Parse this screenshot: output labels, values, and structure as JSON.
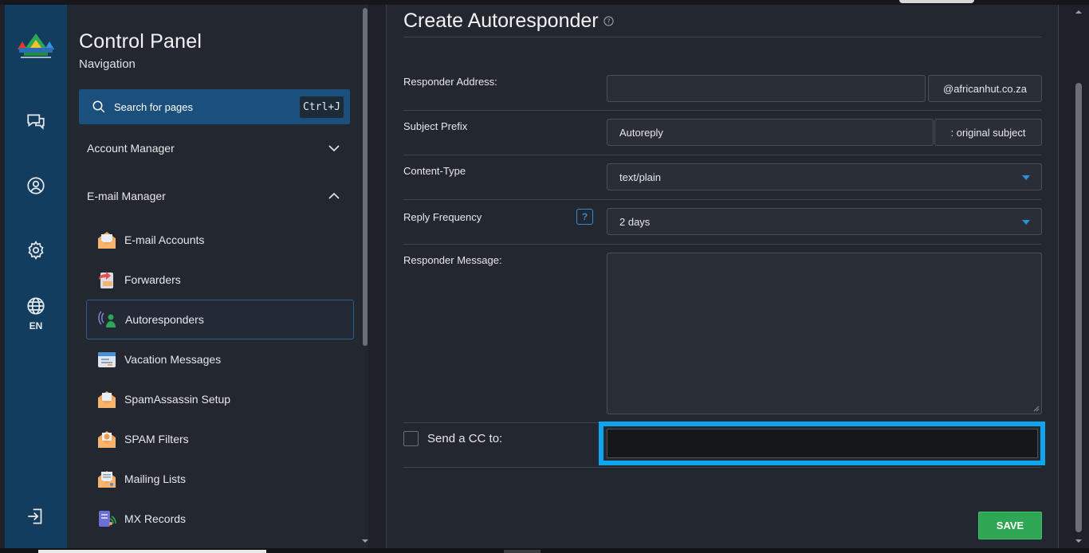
{
  "rail": {
    "language": "EN"
  },
  "sidebar": {
    "title": "Control Panel",
    "subtitle": "Navigation",
    "search": {
      "label": "Search for pages",
      "shortcut": "Ctrl+J"
    },
    "groups": [
      {
        "label": "Account Manager",
        "expanded": false
      },
      {
        "label": "E-mail Manager",
        "expanded": true
      }
    ],
    "items": [
      {
        "label": "E-mail Accounts",
        "icon": "envelope-open-icon"
      },
      {
        "label": "Forwarders",
        "icon": "forward-mail-icon"
      },
      {
        "label": "Autoresponders",
        "icon": "autoresponder-person-icon",
        "active": true
      },
      {
        "label": "Vacation Messages",
        "icon": "calendar-message-icon"
      },
      {
        "label": "SpamAssassin Setup",
        "icon": "envelope-filter-icon"
      },
      {
        "label": "SPAM Filters",
        "icon": "envelope-shield-icon"
      },
      {
        "label": "Mailing Lists",
        "icon": "envelope-list-icon"
      },
      {
        "label": "MX Records",
        "icon": "mx-records-icon"
      }
    ]
  },
  "form": {
    "title": "Create Autoresponder",
    "responder_address": {
      "label": "Responder Address:",
      "value": "",
      "domain": "@africanhut.co.za"
    },
    "subject_prefix": {
      "label": "Subject Prefix",
      "value": "Autoreply",
      "suffix": ": original subject"
    },
    "content_type": {
      "label": "Content-Type",
      "value": "text/plain"
    },
    "reply_frequency": {
      "label": "Reply Frequency",
      "help": "?",
      "value": "2 days"
    },
    "responder_message": {
      "label": "Responder Message:",
      "value": ""
    },
    "send_cc": {
      "label": "Send a CC to:",
      "checked": false,
      "value": ""
    },
    "save_label": "SAVE"
  },
  "colors": {
    "rail_bg": "#133d5f",
    "panel_bg": "#23272f",
    "accent": "#2d8fd5",
    "highlight": "#0ea5ef",
    "save_green": "#2fa653"
  }
}
